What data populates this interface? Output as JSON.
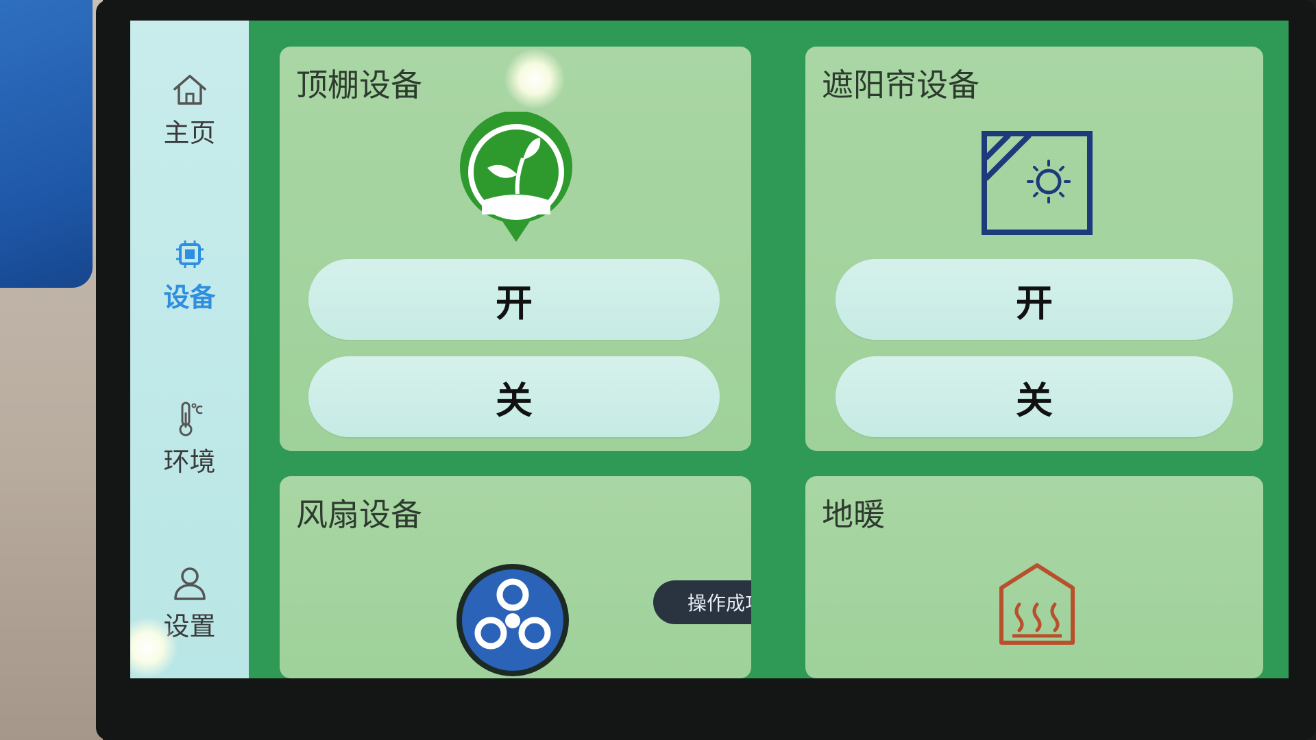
{
  "sidebar": {
    "items": [
      {
        "label": "主页",
        "icon": "home-icon",
        "active": false
      },
      {
        "label": "设备",
        "icon": "chip-icon",
        "active": true
      },
      {
        "label": "环境",
        "icon": "thermometer-icon",
        "active": false
      },
      {
        "label": "设置",
        "icon": "user-icon",
        "active": false
      }
    ]
  },
  "cards": {
    "ceiling": {
      "title": "顶棚设备",
      "icon": "sprout-pin-icon",
      "on_label": "开",
      "off_label": "关"
    },
    "shade": {
      "title": "遮阳帘设备",
      "icon": "sun-window-icon",
      "on_label": "开",
      "off_label": "关"
    },
    "fan": {
      "title": "风扇设备",
      "icon": "fan-icon"
    },
    "floor_heating": {
      "title": "地暖",
      "icon": "heated-house-icon"
    }
  },
  "toast": {
    "text": "操作成功"
  },
  "colors": {
    "screen_bg": "#2f9a55",
    "card_bg": "#a9d6a4",
    "sidebar_bg": "#c9ecec",
    "active_nav": "#2f8ee0",
    "button_bg": "#d6f1ec",
    "toast_bg": "#2a3340"
  }
}
